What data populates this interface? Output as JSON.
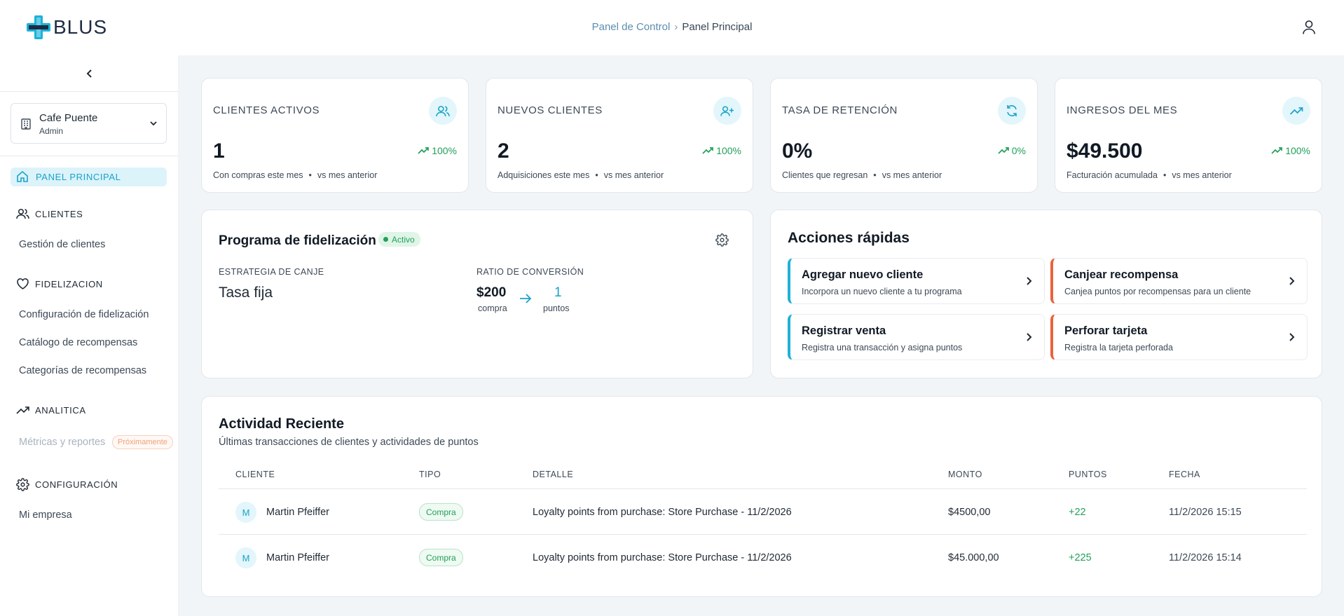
{
  "app": {
    "logo_text": "BLUS"
  },
  "breadcrumb": {
    "parent": "Panel de Control",
    "separator": "›",
    "current": "Panel Principal"
  },
  "sidebar": {
    "business": {
      "name": "Cafe Puente",
      "role": "Admin"
    },
    "active_item": "PANEL PRINCIPAL",
    "sections": {
      "clientes": {
        "label": "CLIENTES",
        "items": [
          "Gestión de clientes"
        ]
      },
      "fidelizacion": {
        "label": "FIDELIZACION",
        "items": [
          "Configuración de fidelización",
          "Catálogo de recompensas",
          "Categorías de recompensas"
        ]
      },
      "analitica": {
        "label": "ANALITICA",
        "items": [
          "Métricas y reportes"
        ],
        "badge": "Próximamente"
      },
      "configuracion": {
        "label": "CONFIGURACIÓN",
        "items": [
          "Mi empresa"
        ]
      }
    }
  },
  "stats": [
    {
      "label": "CLIENTES ACTIVOS",
      "value": "1",
      "trend": "100%",
      "caption": "Con compras este mes",
      "compare": "vs mes anterior",
      "icon": "users-icon"
    },
    {
      "label": "NUEVOS CLIENTES",
      "value": "2",
      "trend": "100%",
      "caption": "Adquisiciones este mes",
      "compare": "vs mes anterior",
      "icon": "user-plus-icon"
    },
    {
      "label": "TASA DE RETENCIÓN",
      "value": "0%",
      "trend": "0%",
      "caption": "Clientes que regresan",
      "compare": "vs mes anterior",
      "icon": "refresh-icon"
    },
    {
      "label": "INGRESOS DEL MES",
      "value": "$49.500",
      "trend": "100%",
      "caption": "Facturación acumulada",
      "compare": "vs mes anterior",
      "icon": "trending-up-icon"
    }
  ],
  "loyalty": {
    "title": "Programa de fidelización",
    "status": "Activo",
    "strategy_label": "ESTRATEGIA DE CANJE",
    "strategy_value": "Tasa fija",
    "ratio_label": "RATIO DE CONVERSIÓN",
    "ratio_amount": "$200",
    "ratio_amount_label": "compra",
    "ratio_points": "1",
    "ratio_points_label": "puntos"
  },
  "quick_actions": {
    "title": "Acciones rápidas",
    "items": [
      {
        "title": "Agregar nuevo cliente",
        "desc": "Incorpora un nuevo cliente a tu programa",
        "accent": "#1fb2d6"
      },
      {
        "title": "Canjear recompensa",
        "desc": "Canjea puntos por recompensas para un cliente",
        "accent": "#e8643a"
      },
      {
        "title": "Registrar venta",
        "desc": "Registra una transacción y asigna puntos",
        "accent": "#1fb2d6"
      },
      {
        "title": "Perforar tarjeta",
        "desc": "Registra la tarjeta perforada",
        "accent": "#e8643a"
      }
    ]
  },
  "activity": {
    "title": "Actividad Reciente",
    "subtitle": "Últimas transacciones de clientes y actividades de puntos",
    "columns": [
      "CLIENTE",
      "TIPO",
      "DETALLE",
      "MONTO",
      "PUNTOS",
      "FECHA"
    ],
    "rows": [
      {
        "initial": "M",
        "client": "Martin Pfeiffer",
        "type": "Compra",
        "detail": "Loyalty points from purchase: Store Purchase - 11/2/2026",
        "amount": "$4500,00",
        "points": "+22",
        "date": "11/2/2026 15:15"
      },
      {
        "initial": "M",
        "client": "Martin Pfeiffer",
        "type": "Compra",
        "detail": "Loyalty points from purchase: Store Purchase - 11/2/2026",
        "amount": "$45.000,00",
        "points": "+225",
        "date": "11/2/2026 15:14"
      }
    ]
  },
  "colors": {
    "accent": "#1aa3c9",
    "success": "#22a05a",
    "warning": "#e8643a",
    "background": "#f1f5f8"
  }
}
